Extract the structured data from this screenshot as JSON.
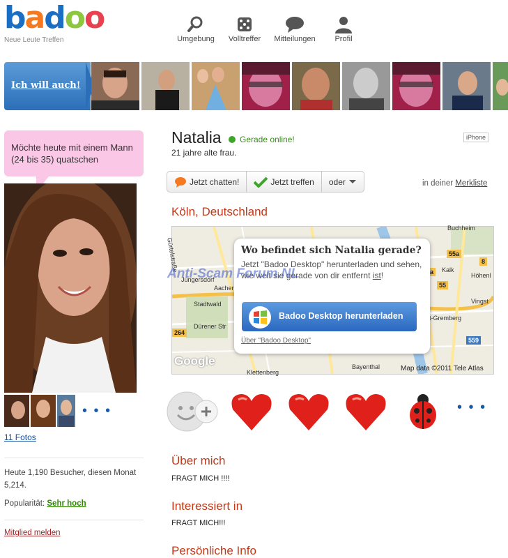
{
  "brand": {
    "logo": "badoo",
    "tagline": "Neue Leute Treffen"
  },
  "nav": [
    {
      "label": "Umgebung",
      "icon": "search-icon"
    },
    {
      "label": "Volltreffer",
      "icon": "dice-icon"
    },
    {
      "label": "Mitteilungen",
      "icon": "chat-icon"
    },
    {
      "label": "Profil",
      "icon": "person-icon"
    }
  ],
  "strip": {
    "promo_label": "Ich will auch!"
  },
  "profile": {
    "status_message": "Möchte heute mit einem Mann (24 bis 35) quatschen",
    "photos_link": "11 Fotos",
    "more_dots": "• • •",
    "visitors_text": "Heute 1,190 Besucher, diesen Monat 5,214.",
    "popularity_label": "Popularität:",
    "popularity_value": "Sehr hoch",
    "report_link": "Mitglied melden",
    "name": "Natalia",
    "online_status": "Gerade online!",
    "age_text": "21 jahre alte frau.",
    "device_badge": "iPhone",
    "location": "Köln, Deutschland"
  },
  "actions": {
    "chat": "Jetzt chatten!",
    "meet": "Jetzt treffen",
    "more": "oder",
    "watchlist_prefix": "in deiner",
    "watchlist_link": "Merkliste"
  },
  "map": {
    "card_title": "Wo befindet sich Natalia gerade?",
    "card_text_1": "Jetzt \"Badoo Desktop\" herunterladen und sehen, wie weit sie gerade von dir entfernt",
    "card_text_link": "ist",
    "card_text_end": "!",
    "download_button": "Badoo Desktop herunterladen",
    "about_link": "Über \"Badoo Desktop\"",
    "watermark": "Anti-Scam Forum.NL",
    "google": "Google",
    "attribution": "Map data ©2011 Tele Atlas",
    "labels": {
      "buchheim": "Buchheim",
      "kalk": "Kalk",
      "hoehenl": "Höhenl",
      "vingst": "Vingst",
      "gremberg": "t-Gremberg",
      "bayenthal": "Bayenthal",
      "klettenberg": "Klettenberg",
      "aachener": "Aachen",
      "junkersdorf": "Jüngersdorf",
      "stadtwald": "Stadtwald",
      "duerener": "Dürener Str",
      "gurtel": "Gürtelstraße"
    },
    "shields": {
      "s55a_top": "55a",
      "s8": "8",
      "s55a_mid": "55a",
      "s55": "55",
      "s264": "264",
      "s559": "559"
    }
  },
  "gifts": {
    "more_dots": "• • •"
  },
  "sections": {
    "about_title": "Über mich",
    "about_text": "FRAGT MICH !!!!",
    "interest_title": "Interessiert in",
    "interest_text": "FRAGT MICH!!!",
    "personal_title": "Persönliche Info"
  },
  "colors": {
    "brand_blue": "#1a6fc4",
    "section_red": "#c03a1a",
    "online_green": "#3fa62a",
    "bubble_pink": "#fbc7e6"
  }
}
